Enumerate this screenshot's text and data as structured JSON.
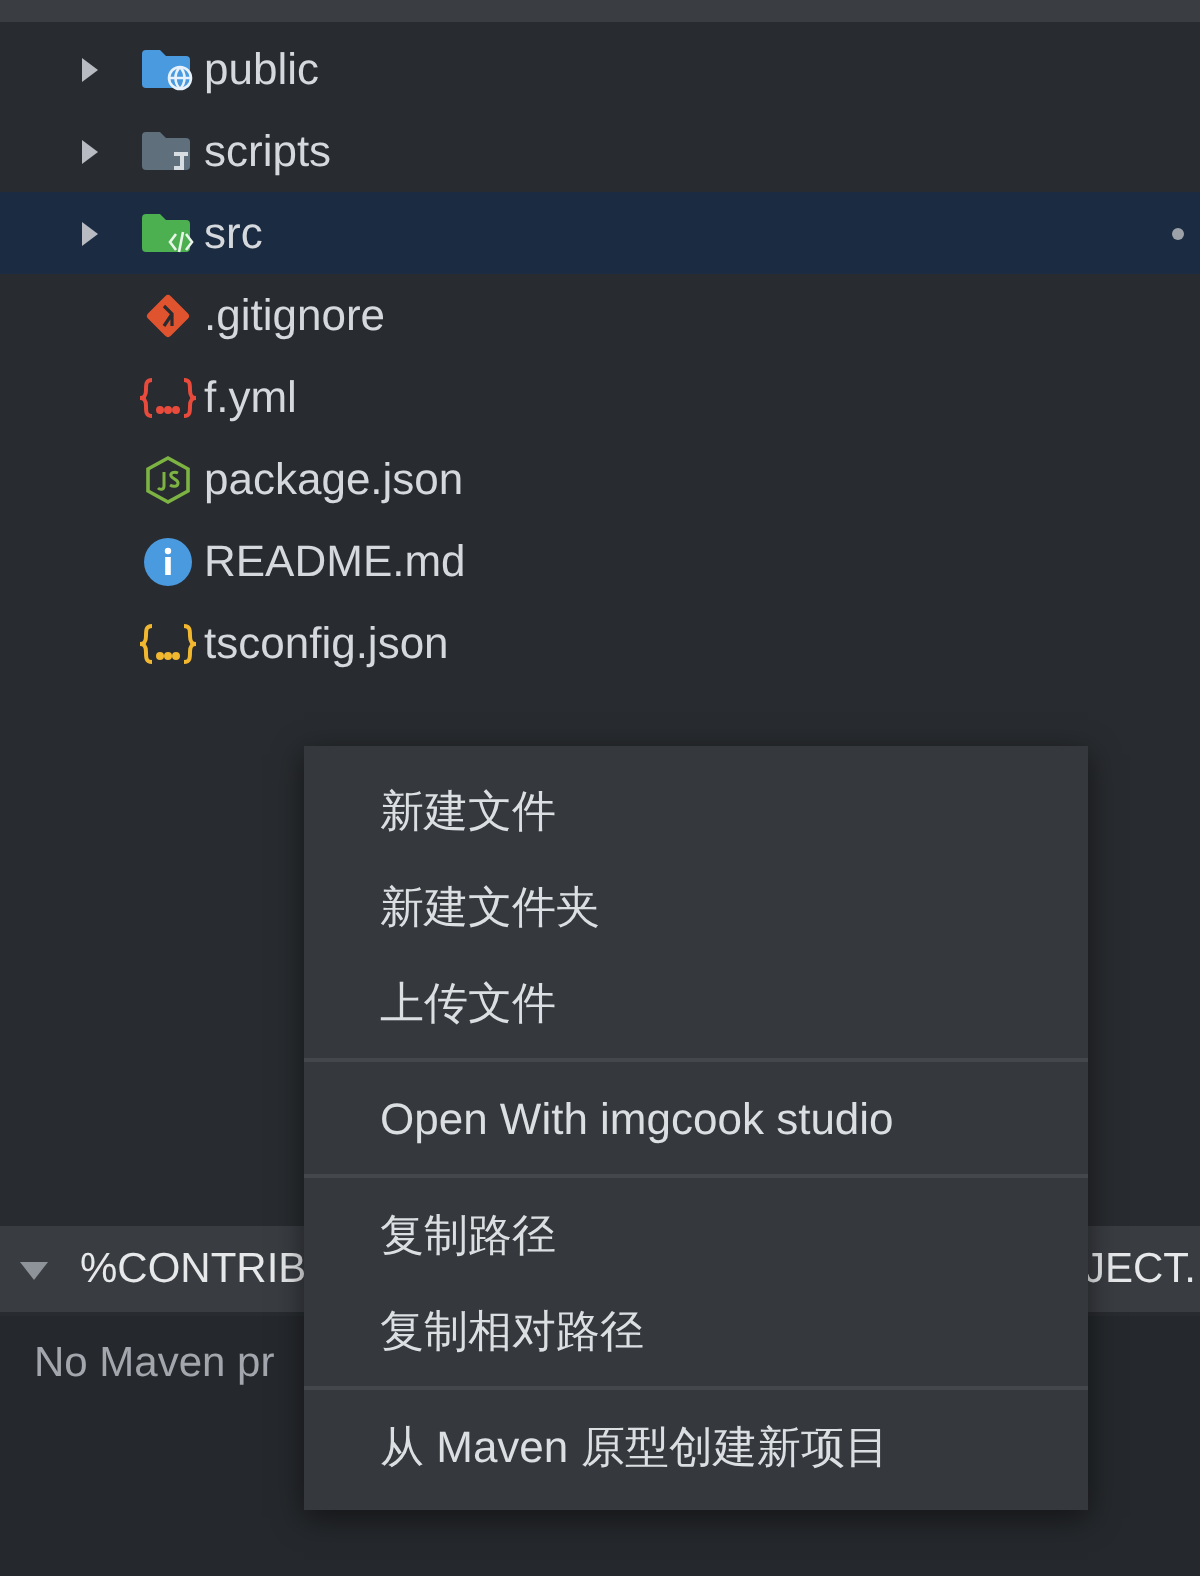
{
  "tree": [
    {
      "name": "public",
      "kind": "folder-web",
      "expandable": true,
      "selected": false,
      "modified": false
    },
    {
      "name": "scripts",
      "kind": "folder-scripts",
      "expandable": true,
      "selected": false,
      "modified": false
    },
    {
      "name": "src",
      "kind": "folder-src",
      "expandable": true,
      "selected": true,
      "modified": true
    },
    {
      "name": ".gitignore",
      "kind": "git",
      "expandable": false,
      "selected": false,
      "modified": false
    },
    {
      "name": "f.yml",
      "kind": "yaml",
      "expandable": false,
      "selected": false,
      "modified": false
    },
    {
      "name": "package.json",
      "kind": "node",
      "expandable": false,
      "selected": false,
      "modified": false
    },
    {
      "name": "README.md",
      "kind": "info",
      "expandable": false,
      "selected": false,
      "modified": false
    },
    {
      "name": "tsconfig.json",
      "kind": "json",
      "expandable": false,
      "selected": false,
      "modified": false
    }
  ],
  "panel": {
    "title_left": "%CONTRIB",
    "title_right": "JECT.",
    "expanded": true,
    "message": "No Maven pr"
  },
  "context_menu": {
    "groups": [
      [
        "新建文件",
        "新建文件夹",
        "上传文件"
      ],
      [
        "Open With imgcook studio"
      ],
      [
        "复制路径",
        "复制相对路径"
      ],
      [
        "从 Maven 原型创建新项目"
      ]
    ]
  }
}
